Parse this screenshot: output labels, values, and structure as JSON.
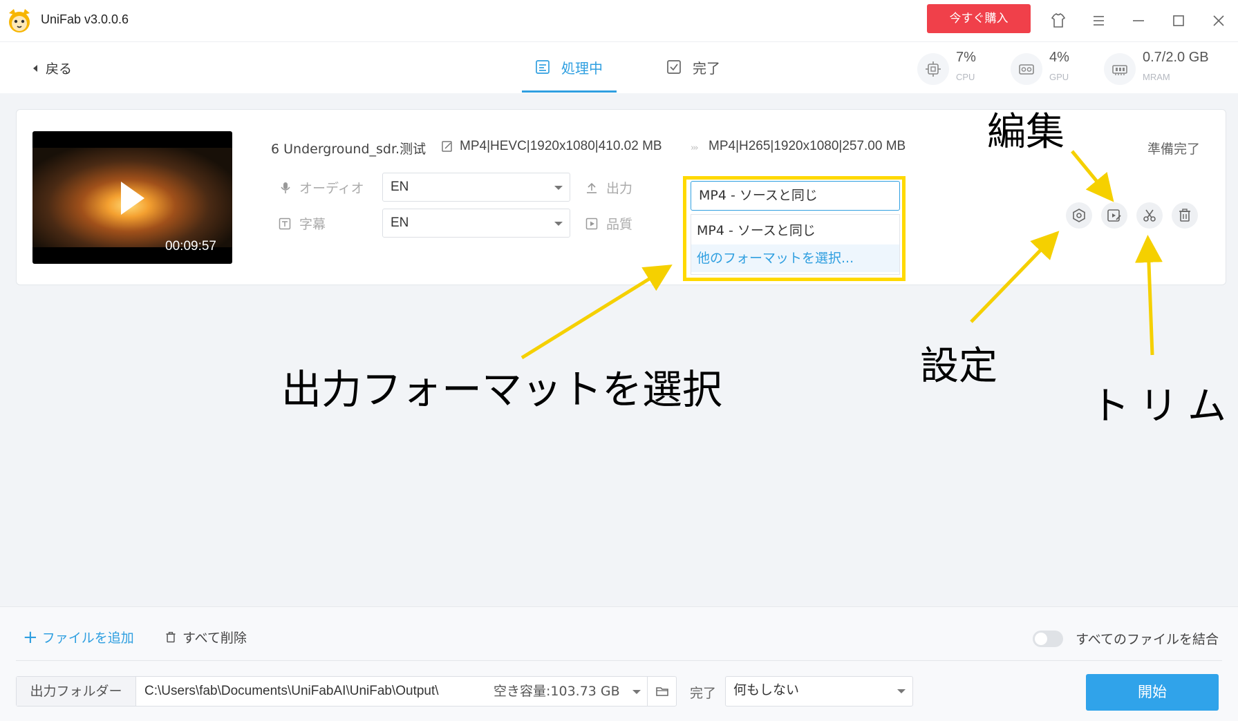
{
  "app": {
    "title": "UniFab v3.0.0.6",
    "buy_label": "今すぐ購入"
  },
  "header": {
    "back_label": "戻る",
    "tabs": [
      {
        "label": "処理中"
      },
      {
        "label": "完了"
      }
    ],
    "meters": [
      {
        "value": "7%",
        "label": "CPU"
      },
      {
        "value": "4%",
        "label": "GPU"
      },
      {
        "value": "0.7/2.0 GB",
        "label": "MRAM"
      }
    ]
  },
  "file": {
    "name": "6 Underground_sdr.测试",
    "duration": "00:09:57",
    "source_info": "MP4|HEVC|1920x1080|410.02 MB",
    "output_info": "MP4|H265|1920x1080|257.00 MB",
    "status": "準備完了",
    "audio_label": "オーディオ",
    "audio_value": "EN",
    "subtitle_label": "字幕",
    "subtitle_value": "EN",
    "output_label": "出力",
    "output_value": "MP4 - ソースと同じ",
    "quality_label": "品質",
    "output_options": [
      "MP4 - ソースと同じ",
      "他のフォーマットを選択..."
    ]
  },
  "annotations": {
    "edit": "編集",
    "settings": "設定",
    "trim": "トリム",
    "select_format": "出力フォーマットを選択",
    "color": "#f5d000"
  },
  "footer": {
    "add_file": "ファイルを追加",
    "delete_all": "すべて削除",
    "merge_label": "すべてのファイルを結合",
    "merge_on": false,
    "output_folder_label": "出力フォルダー",
    "output_path": "C:\\Users\\fab\\Documents\\UniFabAI\\UniFab\\Output\\",
    "free_space": "空き容量:103.73 GB",
    "done_label": "完了",
    "done_action": "何もしない",
    "start_label": "開始"
  },
  "colors": {
    "accent": "#2f9fe0",
    "buy": "#f0404a",
    "start": "#30a3ea"
  }
}
